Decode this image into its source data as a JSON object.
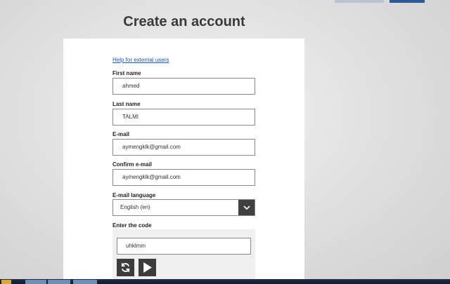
{
  "page": {
    "title": "Create an account"
  },
  "form": {
    "help_link": "Help for external users",
    "first_name": {
      "label": "First name",
      "value": "ahmed"
    },
    "last_name": {
      "label": "Last name",
      "value": "TALMI"
    },
    "email": {
      "label": "E-mail",
      "value": "aymengklk@gmail.com"
    },
    "confirm_email": {
      "label": "Confirm e-mail",
      "value": "aymengklk@gmail.com"
    },
    "email_language": {
      "label": "E-mail language",
      "selected": "English (en)"
    },
    "captcha": {
      "label": "Enter the code",
      "value": "uhklmm"
    }
  },
  "icons": {
    "select_arrow": "chevron-down-icon",
    "refresh": "refresh-icon",
    "play": "play-icon"
  },
  "colors": {
    "link": "#1a57b0",
    "dark_button": "#3c3c3c",
    "top_button_primary": "#2a5a9a"
  }
}
